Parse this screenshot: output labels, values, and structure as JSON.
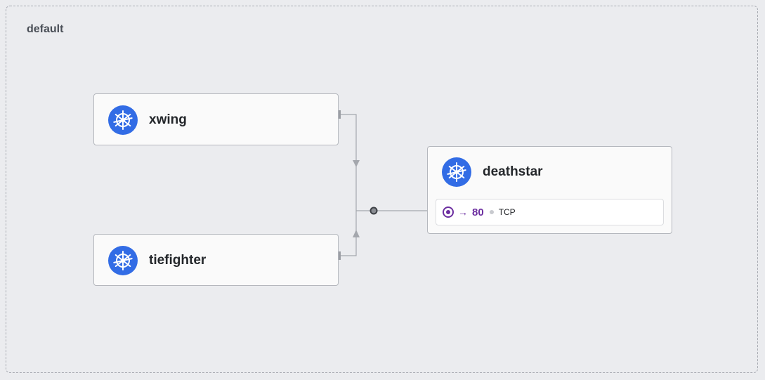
{
  "namespace": {
    "label": "default"
  },
  "services": [
    {
      "id": "xwing",
      "name": "xwing",
      "icon": "kubernetes-icon"
    },
    {
      "id": "tiefighter",
      "name": "tiefighter",
      "icon": "kubernetes-icon"
    },
    {
      "id": "deathstar",
      "name": "deathstar",
      "icon": "kubernetes-icon",
      "ports": [
        {
          "arrow": "→",
          "port": "80",
          "protocol": "TCP"
        }
      ]
    }
  ],
  "colors": {
    "background": "#ebecef",
    "card": "#fafafa",
    "card_border": "#b4b7bd",
    "kubernetes_blue": "#326ce5",
    "port_accent": "#6c2ea0",
    "edge": "#a4a7ad"
  }
}
